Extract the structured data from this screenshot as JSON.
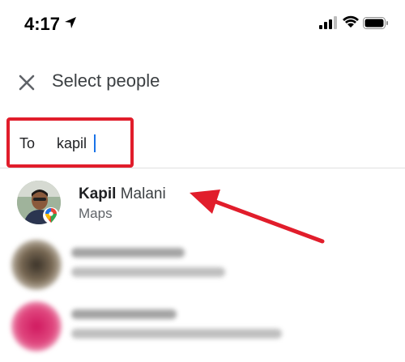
{
  "status_bar": {
    "time": "4:17",
    "location_icon": "location-arrow-icon",
    "signal_icon": "cellular-signal-icon",
    "wifi_icon": "wifi-icon",
    "battery_icon": "battery-icon"
  },
  "header": {
    "close_icon": "close-icon",
    "title": "Select people"
  },
  "to_field": {
    "label": "To",
    "value": "kapil"
  },
  "contacts": [
    {
      "name_match": "Kapil",
      "name_rest": " Malani",
      "source": "Maps",
      "badge_icon": "google-maps-pin-icon"
    }
  ],
  "colors": {
    "annotation_red": "#e11d2b",
    "caret_blue": "#1a73e8",
    "divider": "#e0e0e0"
  }
}
